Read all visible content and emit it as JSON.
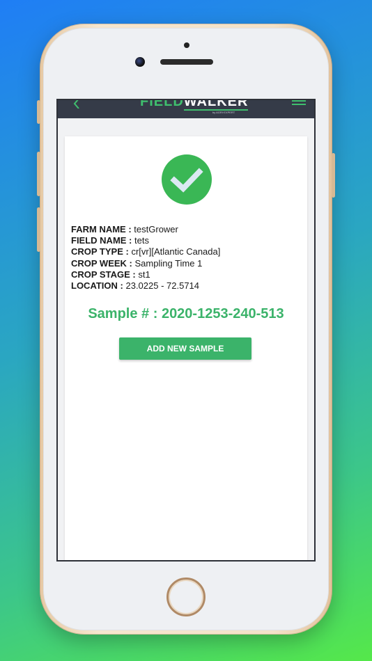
{
  "app": {
    "logo_field": "FIELD",
    "logo_walker": "WALKER",
    "logo_sub": "by AGRI·EXPERT"
  },
  "details": {
    "farm_name": {
      "label": "FARM NAME :",
      "value": "testGrower"
    },
    "field_name": {
      "label": "FIELD NAME :",
      "value": "tets"
    },
    "crop_type": {
      "label": "CROP TYPE :",
      "value": "cr[vr][Atlantic Canada]"
    },
    "crop_week": {
      "label": "CROP WEEK :",
      "value": "Sampling Time 1"
    },
    "crop_stage": {
      "label": "CROP STAGE :",
      "value": "st1"
    },
    "location": {
      "label": "LOCATION :",
      "value": "23.0225 - 72.5714"
    }
  },
  "sample": {
    "label": "Sample # : 2020-1253-240-513"
  },
  "actions": {
    "add_new_sample": "ADD NEW SAMPLE"
  },
  "colors": {
    "accent": "#3bb36a",
    "header": "#353b48",
    "success": "#3ab755"
  },
  "icons": [
    "back-arrow-icon",
    "hamburger-menu-icon",
    "checkmark-icon"
  ]
}
